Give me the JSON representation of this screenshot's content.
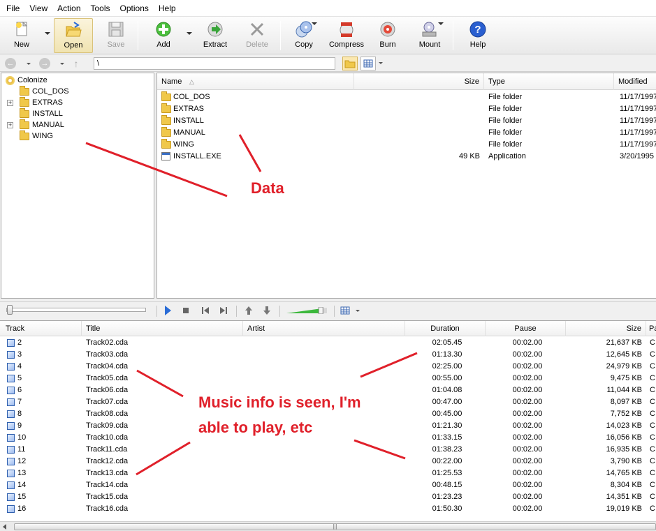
{
  "menu": [
    "File",
    "View",
    "Action",
    "Tools",
    "Options",
    "Help"
  ],
  "toolbar": {
    "new": "New",
    "open": "Open",
    "save": "Save",
    "add": "Add",
    "extract": "Extract",
    "delete": "Delete",
    "copy": "Copy",
    "compress": "Compress",
    "burn": "Burn",
    "mount": "Mount",
    "help": "Help"
  },
  "address": {
    "path": "\\"
  },
  "tree": {
    "root": "Colonize",
    "items": [
      "COL_DOS",
      "EXTRAS",
      "INSTALL",
      "MANUAL",
      "WING"
    ]
  },
  "files": {
    "columns": {
      "name": "Name",
      "size": "Size",
      "type": "Type",
      "modified": "Modified"
    },
    "rows": [
      {
        "name": "COL_DOS",
        "size": "",
        "type": "File folder",
        "modified": "11/17/1997"
      },
      {
        "name": "EXTRAS",
        "size": "",
        "type": "File folder",
        "modified": "11/17/1997"
      },
      {
        "name": "INSTALL",
        "size": "",
        "type": "File folder",
        "modified": "11/17/1997"
      },
      {
        "name": "MANUAL",
        "size": "",
        "type": "File folder",
        "modified": "11/17/1997"
      },
      {
        "name": "WING",
        "size": "",
        "type": "File folder",
        "modified": "11/17/1997"
      },
      {
        "name": "INSTALL.EXE",
        "size": "49 KB",
        "type": "Application",
        "modified": "3/20/1995"
      }
    ]
  },
  "player": {
    "seek_fraction": 0.0,
    "volume_fraction": 0.85
  },
  "tracks": {
    "columns": {
      "track": "Track",
      "title": "Title",
      "artist": "Artist",
      "duration": "Duration",
      "pause": "Pause",
      "size": "Size",
      "extra": "Pa"
    },
    "rows": [
      {
        "track": "2",
        "title": "Track02.cda",
        "artist": "",
        "duration": "02:05.45",
        "pause": "00:02.00",
        "size": "21,637 KB",
        "extra": "C"
      },
      {
        "track": "3",
        "title": "Track03.cda",
        "artist": "",
        "duration": "01:13.30",
        "pause": "00:02.00",
        "size": "12,645 KB",
        "extra": "C"
      },
      {
        "track": "4",
        "title": "Track04.cda",
        "artist": "",
        "duration": "02:25.00",
        "pause": "00:02.00",
        "size": "24,979 KB",
        "extra": "C"
      },
      {
        "track": "5",
        "title": "Track05.cda",
        "artist": "",
        "duration": "00:55.00",
        "pause": "00:02.00",
        "size": "9,475 KB",
        "extra": "C"
      },
      {
        "track": "6",
        "title": "Track06.cda",
        "artist": "",
        "duration": "01:04.08",
        "pause": "00:02.00",
        "size": "11,044 KB",
        "extra": "C"
      },
      {
        "track": "7",
        "title": "Track07.cda",
        "artist": "",
        "duration": "00:47.00",
        "pause": "00:02.00",
        "size": "8,097 KB",
        "extra": "C"
      },
      {
        "track": "8",
        "title": "Track08.cda",
        "artist": "",
        "duration": "00:45.00",
        "pause": "00:02.00",
        "size": "7,752 KB",
        "extra": "C"
      },
      {
        "track": "9",
        "title": "Track09.cda",
        "artist": "",
        "duration": "01:21.30",
        "pause": "00:02.00",
        "size": "14,023 KB",
        "extra": "C"
      },
      {
        "track": "10",
        "title": "Track10.cda",
        "artist": "",
        "duration": "01:33.15",
        "pause": "00:02.00",
        "size": "16,056 KB",
        "extra": "C"
      },
      {
        "track": "11",
        "title": "Track11.cda",
        "artist": "",
        "duration": "01:38.23",
        "pause": "00:02.00",
        "size": "16,935 KB",
        "extra": "C"
      },
      {
        "track": "12",
        "title": "Track12.cda",
        "artist": "",
        "duration": "00:22.00",
        "pause": "00:02.00",
        "size": "3,790 KB",
        "extra": "C"
      },
      {
        "track": "13",
        "title": "Track13.cda",
        "artist": "",
        "duration": "01:25.53",
        "pause": "00:02.00",
        "size": "14,765 KB",
        "extra": "C"
      },
      {
        "track": "14",
        "title": "Track14.cda",
        "artist": "",
        "duration": "00:48.15",
        "pause": "00:02.00",
        "size": "8,304 KB",
        "extra": "C"
      },
      {
        "track": "15",
        "title": "Track15.cda",
        "artist": "",
        "duration": "01:23.23",
        "pause": "00:02.00",
        "size": "14,351 KB",
        "extra": "C"
      },
      {
        "track": "16",
        "title": "Track16.cda",
        "artist": "",
        "duration": "01:50.30",
        "pause": "00:02.00",
        "size": "19,019 KB",
        "extra": "C"
      }
    ]
  },
  "annotations": {
    "data": "Data",
    "music_line1": "Music info is seen, I'm",
    "music_line2": "able to play, etc",
    "color": "#e0202a"
  },
  "colors": {
    "folder": "#f0c84a",
    "play": "#2a6cd6",
    "help": "#2a5fd0",
    "volume": "#3cb83c"
  }
}
